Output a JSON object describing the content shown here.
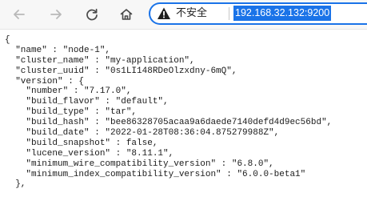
{
  "browser": {
    "security_label": "不安全",
    "url": "192.168.32.132:9200"
  },
  "json_lines": [
    "{",
    "  \"name\" : \"node-1\",",
    "  \"cluster_name\" : \"my-application\",",
    "  \"cluster_uuid\" : \"0s1LI148RDeOlzxdny-6mQ\",",
    "  \"version\" : {",
    "    \"number\" : \"7.17.0\",",
    "    \"build_flavor\" : \"default\",",
    "    \"build_type\" : \"tar\",",
    "    \"build_hash\" : \"bee86328705acaa9a6daede7140defd4d9ec56bd\",",
    "    \"build_date\" : \"2022-01-28T08:36:04.875279988Z\",",
    "    \"build_snapshot\" : false,",
    "    \"lucene_version\" : \"8.11.1\",",
    "    \"minimum_wire_compatibility_version\" : \"6.8.0\",",
    "    \"minimum_index_compatibility_version\" : \"6.0.0-beta1\"",
    "  },"
  ]
}
